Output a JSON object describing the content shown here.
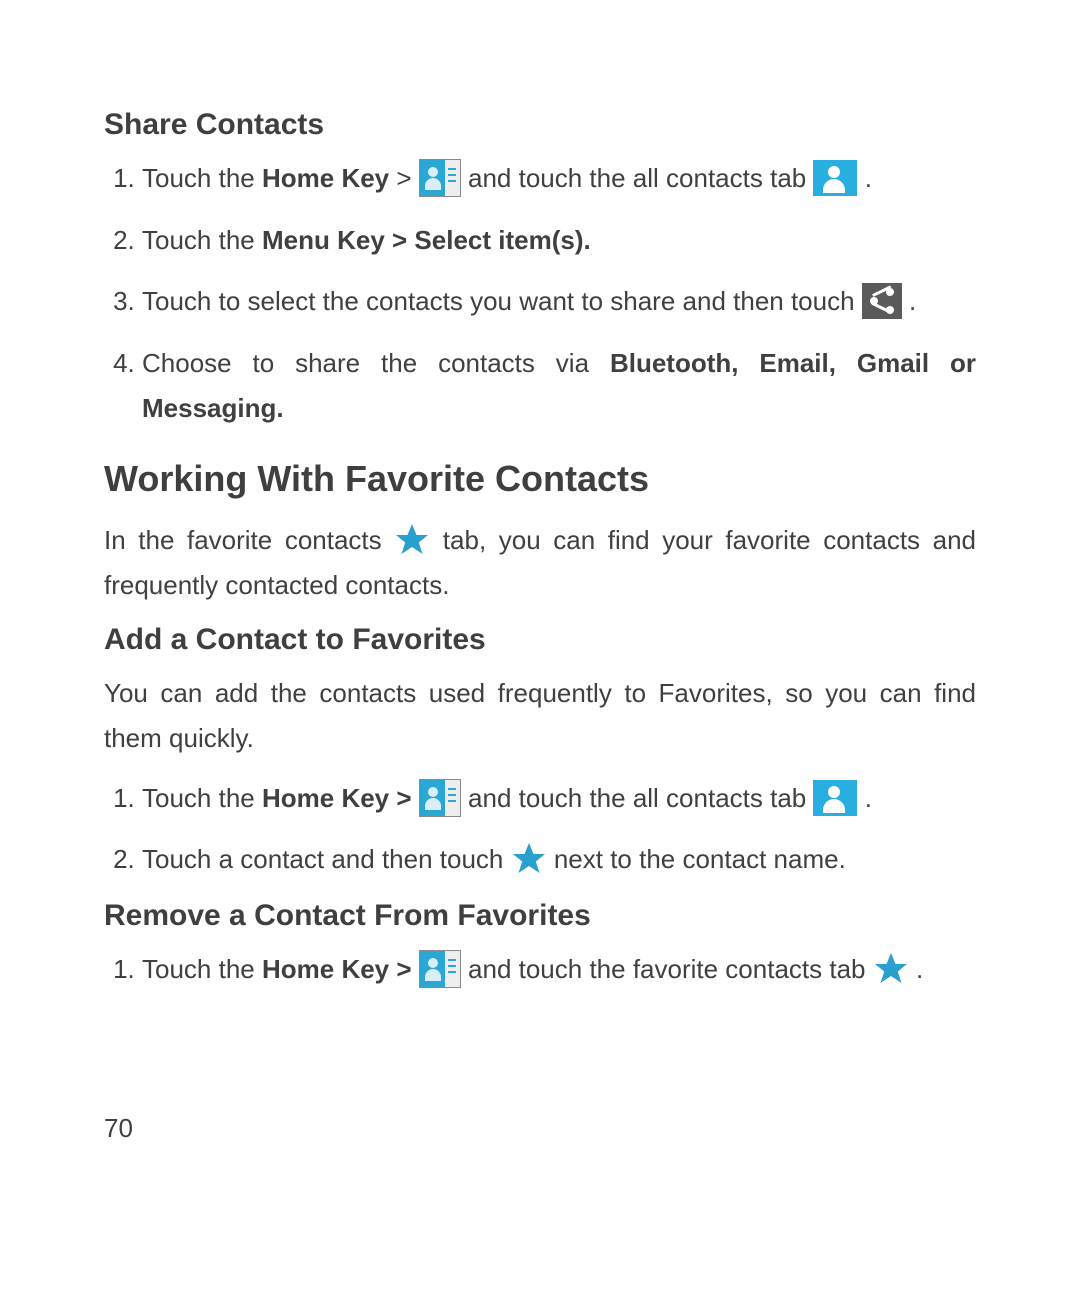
{
  "section1": {
    "title": "Share Contacts",
    "steps": {
      "s1a": "Touch the ",
      "s1b": "Home Key",
      "s1c": " > ",
      "s1d": " and touch the all contacts tab ",
      "s1e": " .",
      "s2a": "Touch the ",
      "s2b": "Menu Key > Select item(s).",
      "s3a": "Touch to select the contacts you want to share and then touch ",
      "s3b": " .",
      "s4a": "Choose to share the contacts via ",
      "s4b": "Bluetooth, Email, Gmail or Messaging."
    }
  },
  "section2": {
    "title": "Working With Favorite Contacts",
    "intro_a": "In the favorite contacts ",
    "intro_b": " tab, you can find your favorite contacts and frequently contacted contacts."
  },
  "section3": {
    "title": "Add a Contact to Favorites",
    "intro": "You can add the contacts used frequently to Favorites, so you can find them quickly.",
    "steps": {
      "s1a": "Touch the ",
      "s1b": "Home Key >",
      "s1c": " ",
      "s1d": " and touch the all contacts tab ",
      "s1e": " .",
      "s2a": "Touch a contact and then touch ",
      "s2b": " next to the contact name."
    }
  },
  "section4": {
    "title": "Remove a Contact From Favorites",
    "steps": {
      "s1a": "Touch the ",
      "s1b": "Home Key >",
      "s1c": " ",
      "s1d": " and touch the favorite contacts tab ",
      "s1e": " ."
    }
  },
  "page_number": "70"
}
